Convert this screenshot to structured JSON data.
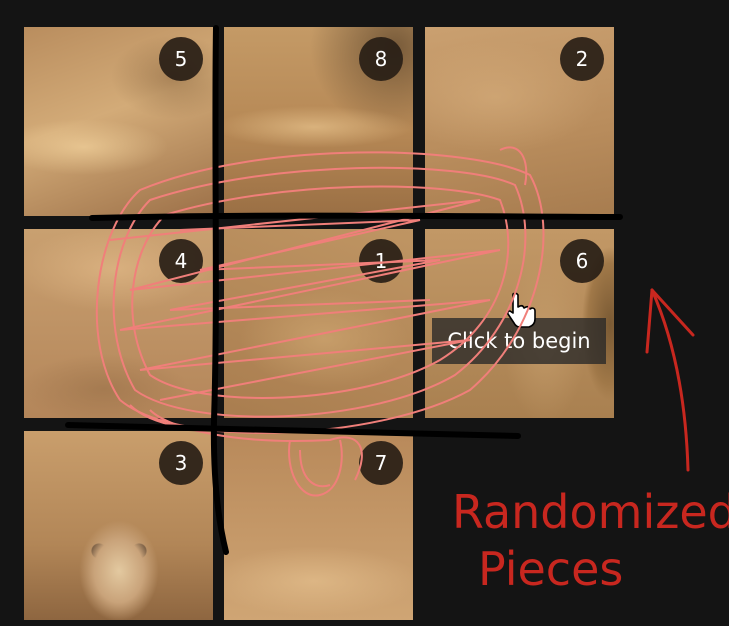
{
  "puzzle": {
    "tiles": [
      {
        "label": "5",
        "texture": "sand-a"
      },
      {
        "label": "8",
        "texture": "sand-b"
      },
      {
        "label": "2",
        "texture": "sand-c"
      },
      {
        "label": "4",
        "texture": "sand-d"
      },
      {
        "label": "1",
        "texture": "sand-e"
      },
      {
        "label": "6",
        "texture": "meerkat-side"
      },
      {
        "label": "3",
        "texture": "meerkat-face"
      },
      {
        "label": "7",
        "texture": "sand-f"
      }
    ],
    "start_hint": "Click to begin"
  },
  "annotation": {
    "line1": "Randomized",
    "line2": "Pieces",
    "ink_color": "#c8271f",
    "scribble_color": "#f07f7a"
  },
  "icons": {
    "cursor": "hand-pointer-icon"
  }
}
